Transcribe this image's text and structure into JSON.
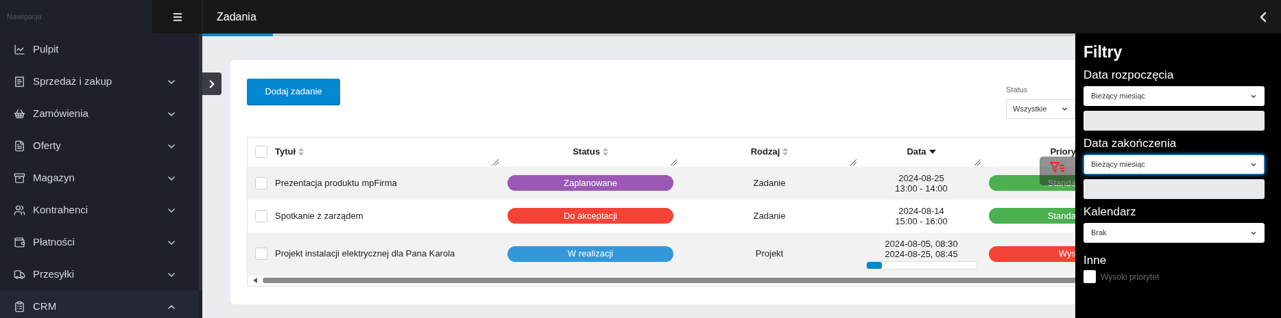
{
  "sidebar": {
    "title": "Nawigacja",
    "items": [
      {
        "label": "Pulpit"
      },
      {
        "label": "Sprzedaż i zakup",
        "expanded": false
      },
      {
        "label": "Zamówienia",
        "expanded": false
      },
      {
        "label": "Oferty",
        "expanded": false
      },
      {
        "label": "Magazyn",
        "expanded": false
      },
      {
        "label": "Kontrahenci",
        "expanded": false
      },
      {
        "label": "Płatności",
        "expanded": false
      },
      {
        "label": "Przesyłki",
        "expanded": false
      },
      {
        "label": "CRM",
        "expanded": true
      }
    ]
  },
  "header": {
    "title": "Zadania"
  },
  "toolbar": {
    "add_button": "Dodaj zadanie",
    "status_filter": {
      "label": "Status",
      "value": "Wszystkie"
    }
  },
  "table": {
    "all_checked": false,
    "columns": [
      {
        "label": "Tytuł",
        "sorted": false
      },
      {
        "label": "Status",
        "sorted": false
      },
      {
        "label": "Rodzaj",
        "sorted": false
      },
      {
        "label": "Data",
        "sorted": true
      },
      {
        "label": "Priory"
      }
    ],
    "rows": [
      {
        "checked": false,
        "title": "Prezentacja produktu mpFirma",
        "status": {
          "label": "Zaplanowane",
          "color": "#9b59b6"
        },
        "type": "Zadanie",
        "date": [
          "2024-08-25",
          "13:00 - 14:00"
        ],
        "priority": {
          "label": "Standa",
          "color": "#4caf50"
        }
      },
      {
        "checked": false,
        "title": "Spotkanie z zarządem",
        "status": {
          "label": "Do akceptacji",
          "color": "#f44336"
        },
        "type": "Zadanie",
        "date": [
          "2024-08-14",
          "15:00 - 16:00"
        ],
        "priority": {
          "label": "Standa",
          "color": "#4caf50"
        }
      },
      {
        "checked": false,
        "title": "Projekt instalacji elektrycznej dla Pana Karola",
        "status": {
          "label": "W realizacji",
          "color": "#3498db"
        },
        "type": "Projekt",
        "date": [
          "2024-08-05, 08:30",
          "2024-08-25, 08:45"
        ],
        "progress": {
          "level": 0.14
        },
        "priority": {
          "label": "Wys",
          "color": "#f44336"
        }
      }
    ]
  },
  "filters": {
    "title": "Filtry",
    "groups": [
      {
        "kind": "date",
        "label": "Data rozpoczęcia",
        "value": "Bieżący miesiąc",
        "focused": false
      },
      {
        "kind": "date",
        "label": "Data zakończenia",
        "value": "Bieżący miesiąc",
        "focused": true
      },
      {
        "kind": "select",
        "label": "Kalendarz",
        "value": "Brak",
        "focused": false
      },
      {
        "kind": "checkbox",
        "label": "Inne",
        "option": "Wysoki priorytet",
        "checked": false
      }
    ]
  }
}
